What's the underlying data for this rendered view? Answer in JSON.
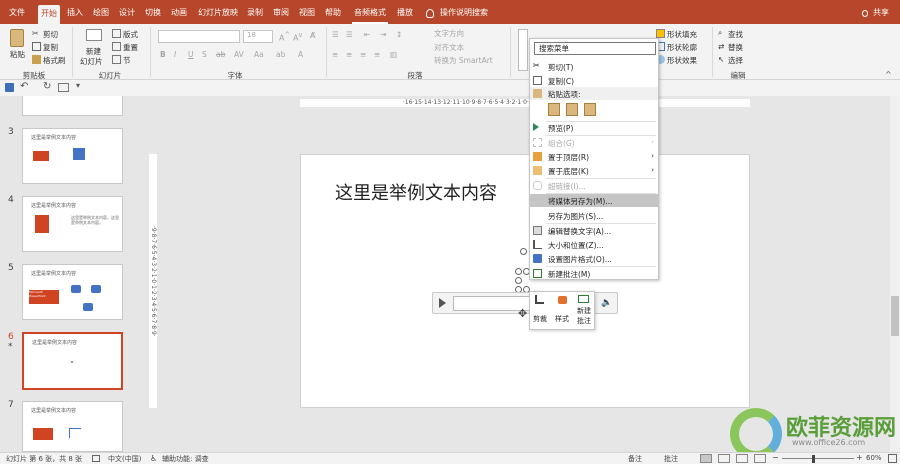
{
  "tabs": [
    "文件",
    "开始",
    "插入",
    "绘图",
    "设计",
    "切换",
    "动画",
    "幻灯片放映",
    "录制",
    "审阅",
    "视图",
    "帮助",
    "音频格式",
    "播放"
  ],
  "active_tab": "开始",
  "search_hint": "操作说明搜索",
  "share": "共享",
  "ribbon": {
    "clipboard": {
      "paste": "粘贴",
      "cut": "剪切",
      "copy": "复制",
      "format_painter": "格式刷",
      "group": "剪贴板"
    },
    "slides": {
      "new_slide_1": "新建",
      "new_slide_2": "幻灯片",
      "layout": "版式",
      "reset": "重置",
      "section": "节",
      "group": "幻灯片"
    },
    "font": {
      "size": "18",
      "group": "字体"
    },
    "paragraph": {
      "text_dir": "文字方向",
      "align_text": "对齐文本",
      "smartart": "转换为 SmartArt",
      "group": "段落"
    },
    "drawing": {
      "fill": "形状填充",
      "outline": "形状轮廓",
      "effects": "形状效果"
    },
    "editing": {
      "find": "查找",
      "replace": "替换",
      "select": "选择",
      "group": "编辑"
    }
  },
  "rulers": {
    "horizontal": "·16·15·14·13·12·11·10·9·8·7·6·5·4·3·2·1·0·1·2·3·4·5·6·7·8·9·10·11·12·13·14·15·16·",
    "vertical": "·9·8·7·6·5·4·3·2·1·0·1·2·3·4·5·6·7·8·9·"
  },
  "thumbnails": [
    {
      "num": "3",
      "title": "这里是举例文本内容",
      "selected": false
    },
    {
      "num": "4",
      "title": "这里是举例文本内容",
      "selected": false,
      "body": "这里是举例文本内容，这里是举例文本内容。"
    },
    {
      "num": "5",
      "title": "这里是举例文本内容",
      "selected": false,
      "box": "Microsoft PowerPoint"
    },
    {
      "num": "6",
      "title": "这里是举例文本内容",
      "selected": true,
      "star": "*"
    },
    {
      "num": "7",
      "title": "这里是举例文本内容",
      "selected": false
    }
  ],
  "slide_text": "这里是举例文本内容",
  "context_menu": {
    "search": "搜索菜单",
    "items": [
      {
        "label": "剪切(T)",
        "icon": "scissors-icon",
        "disabled": false
      },
      {
        "label": "复制(C)",
        "icon": "copy-icon",
        "disabled": false
      },
      {
        "label": "粘贴选项:",
        "icon": "paste-icon",
        "disabled": false,
        "highlight_bg": true
      },
      {
        "label": "预览(P)",
        "icon": "play-icon",
        "disabled": false
      },
      {
        "label": "组合(G)",
        "icon": "group-icon",
        "disabled": true,
        "submenu": true
      },
      {
        "label": "置于顶层(R)",
        "icon": "bring-front-icon",
        "disabled": false,
        "submenu": true
      },
      {
        "label": "置于底层(K)",
        "icon": "send-back-icon",
        "disabled": false,
        "submenu": true
      },
      {
        "label": "超链接(I)...",
        "icon": "link-icon",
        "disabled": true
      },
      {
        "label": "将媒体另存为(M)...",
        "icon": "",
        "disabled": false,
        "highlight": true
      },
      {
        "label": "另存为图片(S)...",
        "icon": "",
        "disabled": false
      },
      {
        "label": "编辑替换文字(A)...",
        "icon": "alt-text-icon",
        "disabled": false
      },
      {
        "label": "大小和位置(Z)...",
        "icon": "size-icon",
        "disabled": false
      },
      {
        "label": "设置图片格式(O)...",
        "icon": "format-picture-icon",
        "disabled": false
      },
      {
        "label": "新建批注(M)",
        "icon": "comment-icon",
        "disabled": false
      }
    ]
  },
  "mini_toolbar": {
    "trim": "剪裁",
    "style": "样式",
    "new_comment_1": "新建",
    "new_comment_2": "批注"
  },
  "status": {
    "slide_info": "幻灯片 第 6 张，共 8 张",
    "language": "中文(中国)",
    "accessibility": "辅助功能: 调查",
    "notes": "备注",
    "comments": "批注",
    "zoom": "60%"
  },
  "watermark": {
    "brand": "欧菲资源网",
    "url": "www.office26.com"
  },
  "colors": {
    "accent": "#b7472a",
    "selected_border": "#d04423",
    "shape_blue": "#4472c4",
    "ppt_orange": "#d04423"
  }
}
